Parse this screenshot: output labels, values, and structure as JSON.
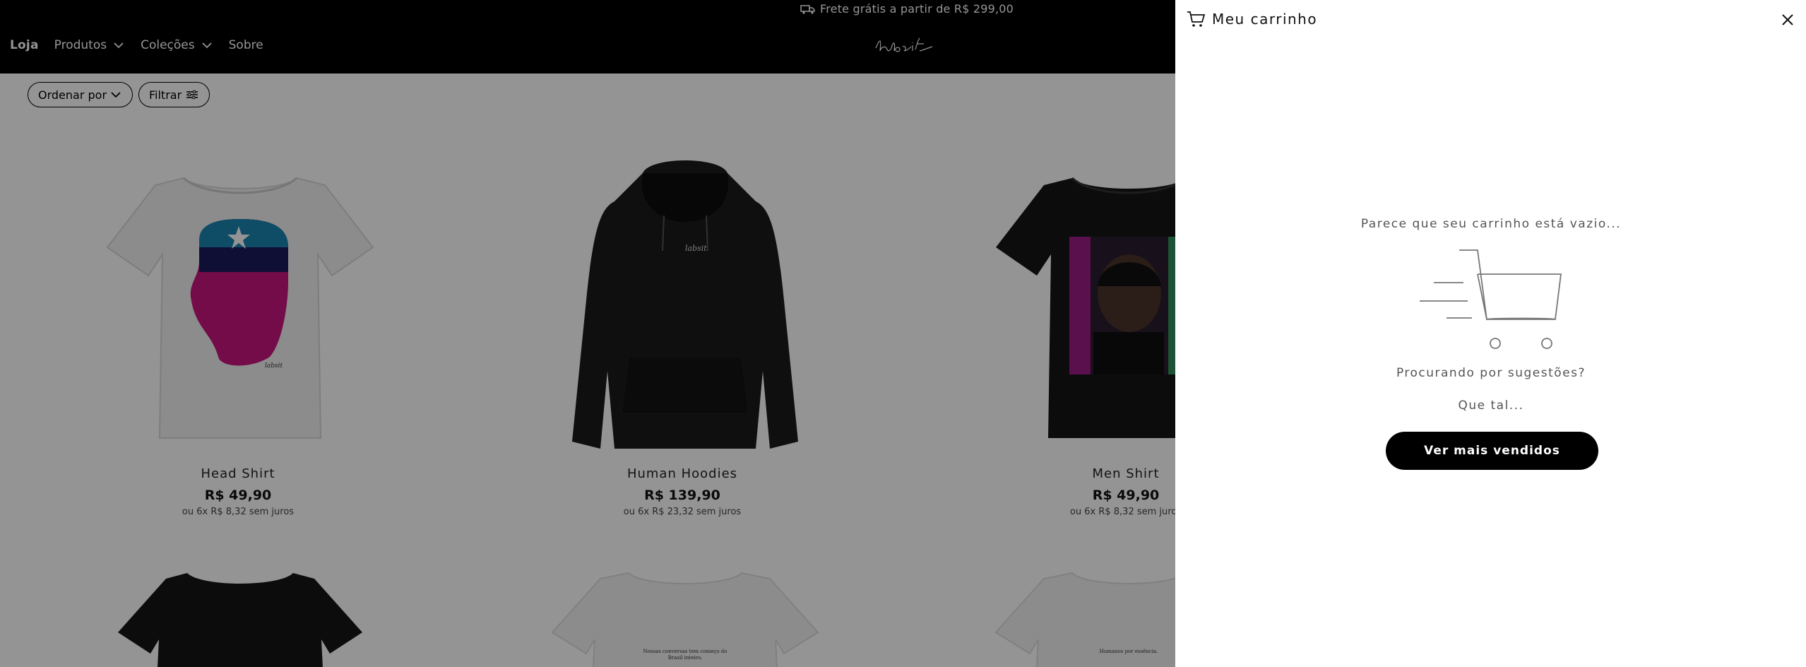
{
  "header": {
    "announcement": "Frete grátis a partir de R$ 299,00",
    "nav": {
      "brand": "Loja",
      "items": [
        "Produtos",
        "Coleções",
        "Sobre"
      ]
    },
    "logo_text": "labsit"
  },
  "toolbar": {
    "sort_label": "Ordenar por",
    "filter_label": "Filtrar"
  },
  "products": [
    {
      "name": "Head Shirt",
      "price": "R$ 49,90",
      "installments": "ou 6x R$ 8,32 sem juros"
    },
    {
      "name": "Human Hoodies",
      "price": "R$ 139,90",
      "installments": "ou 6x R$ 23,32 sem juros"
    },
    {
      "name": "Men Shirt",
      "price": "R$ 49,90",
      "installments": "ou 6x R$ 8,32 sem juros"
    }
  ],
  "bottom_row_prints": {
    "second": "Nossas conversas tem começo do Brasil inteiro.",
    "third": "Humanos por essência."
  },
  "cart": {
    "title": "Meu carrinho",
    "empty_message": "Parece que seu carrinho está vazio...",
    "suggestions": "Procurando por sugestões?",
    "que_tal": "Que tal...",
    "cta_label": "Ver mais vendidos"
  },
  "colors": {
    "header_bg": "#000000",
    "overlay": "rgba(0,0,0,0.42)",
    "cta_bg": "#000000",
    "head_pink": "#c8157f",
    "head_navy": "#1b1a5e",
    "head_teal": "#1b85b1"
  }
}
